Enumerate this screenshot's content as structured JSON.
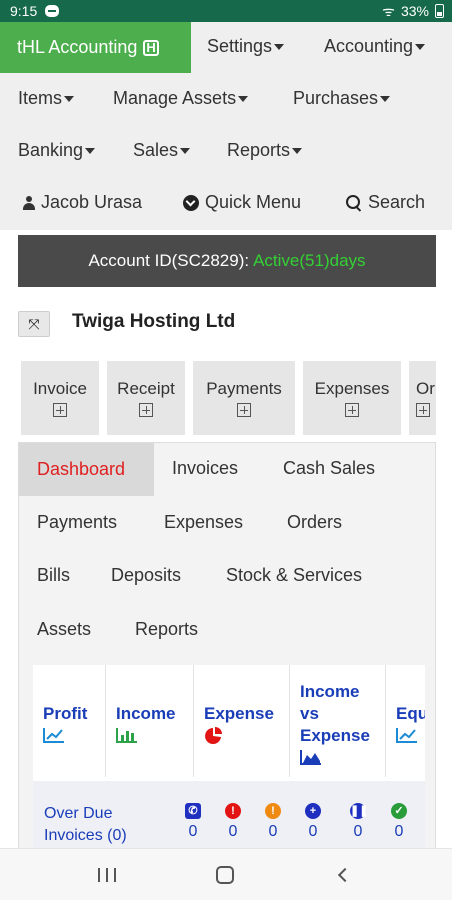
{
  "status_bar": {
    "time": "9:15",
    "battery": "33%"
  },
  "nav": {
    "brand": "tHL Accounting",
    "menus": [
      "Settings",
      "Accounting",
      "Items",
      "Manage Assets",
      "Purchases",
      "Banking",
      "Sales",
      "Reports"
    ],
    "user": "Jacob Urasa",
    "quick_menu": "Quick Menu",
    "search": "Search"
  },
  "account": {
    "label": "Account ID(SC2829):",
    "status": "Active(51)days"
  },
  "company": {
    "name": "Twiga Hosting Ltd"
  },
  "quick_actions": [
    "Invoice",
    "Receipt",
    "Payments",
    "Expenses",
    "Or"
  ],
  "tabs": [
    "Dashboard",
    "Invoices",
    "Cash Sales",
    "Payments",
    "Expenses",
    "Orders",
    "Bills",
    "Deposits",
    "Stock & Services",
    "Assets",
    "Reports"
  ],
  "dashboard": {
    "cards": [
      {
        "line1": "Profit",
        "line2": "",
        "icon": "line-chart-icon"
      },
      {
        "line1": "Income",
        "line2": "",
        "icon": "bar-chart-icon"
      },
      {
        "line1": "Expense",
        "line2": "",
        "icon": "pie-chart-icon"
      },
      {
        "line1": "Income",
        "line2": "vs",
        "line3": "Expense",
        "icon": "area-chart-icon"
      },
      {
        "line1": "Equ",
        "line2": "",
        "icon": "line-chart-icon"
      }
    ],
    "overdue": {
      "line1": "Over Due",
      "line2": "Invoices (0)"
    },
    "stats": [
      {
        "icon": "phone-icon",
        "value": "0",
        "color": "#1f2fbf"
      },
      {
        "icon": "alert-icon",
        "value": "0",
        "color": "#e31414"
      },
      {
        "icon": "warning-icon",
        "value": "0",
        "color": "#ef8a12"
      },
      {
        "icon": "user-plus-icon",
        "value": "0",
        "color": "#1f2fbf"
      },
      {
        "icon": "pause-icon",
        "value": "0",
        "color": "#1f2fbf"
      },
      {
        "icon": "check-icon",
        "value": "0",
        "color": "#2a9d3a"
      }
    ]
  },
  "colors": {
    "brand": "#4cae4c",
    "status_bar": "#16694a",
    "active_text": "#34d034",
    "link": "#1a3db8",
    "active_tab": "#e02020"
  }
}
